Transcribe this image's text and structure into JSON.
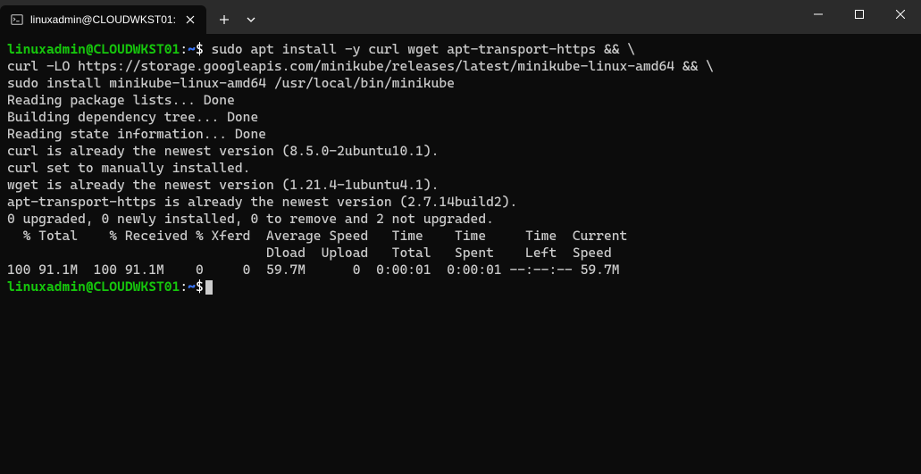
{
  "titlebar": {
    "tab_title": "linuxadmin@CLOUDWKST01:"
  },
  "prompt": {
    "user_host": "linuxadmin@CLOUDWKST01",
    "colon": ":",
    "path": "~",
    "dollar": "$"
  },
  "command": {
    "line1": "sudo apt install -y curl wget apt-transport-https && \\",
    "line2": "curl -LO https://storage.googleapis.com/minikube/releases/latest/minikube-linux-amd64 && \\",
    "line3": "sudo install minikube-linux-amd64 /usr/local/bin/minikube"
  },
  "output": {
    "l1": "Reading package lists... Done",
    "l2": "Building dependency tree... Done",
    "l3": "Reading state information... Done",
    "l4": "curl is already the newest version (8.5.0-2ubuntu10.1).",
    "l5": "curl set to manually installed.",
    "l6": "wget is already the newest version (1.21.4-1ubuntu4.1).",
    "l7": "apt-transport-https is already the newest version (2.7.14build2).",
    "l8": "0 upgraded, 0 newly installed, 0 to remove and 2 not upgraded.",
    "l9": "  % Total    % Received % Xferd  Average Speed   Time    Time     Time  Current",
    "l10": "                                 Dload  Upload   Total   Spent    Left  Speed",
    "l11": "100 91.1M  100 91.1M    0     0  59.7M      0  0:00:01  0:00:01 --:--:-- 59.7M"
  }
}
